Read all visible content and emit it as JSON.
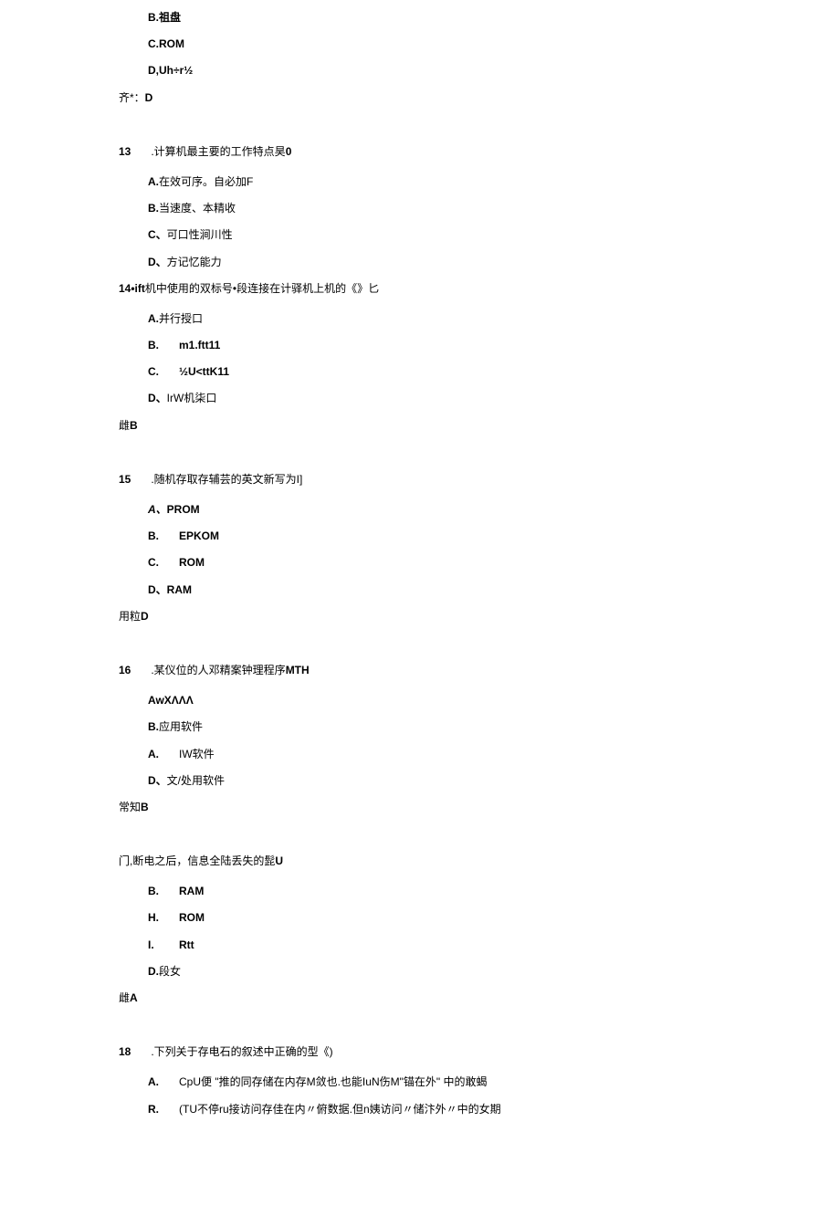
{
  "q12": {
    "optB": "B.祖盘",
    "optC": "C.ROM",
    "optD": "D,Uh÷r½",
    "answer_pre": "齐*：",
    "answer_val": "D"
  },
  "q13": {
    "num": "13",
    "text": ".计算机最主要的工作特点昊",
    "end": "0",
    "optA_pre": "A.",
    "optA": "在效可序。自必加F",
    "optB_pre": "B.",
    "optB": "当速度、本精收",
    "optC_pre": "C、",
    "optC": "可口性涧川性",
    "optD_pre": "D、",
    "optD": "方记忆能力"
  },
  "q14": {
    "num": "14•ift",
    "text": "机中使用的双标号•段连接在计驿机上机的《》匕",
    "optA_pre": "A.",
    "optA": "并行授口",
    "optB_pre": "B.",
    "optB": "m1.ftt11",
    "optC_pre": "C.",
    "optC": "½U<ttK11",
    "optD_pre": "D、",
    "optD": "IrW机柒口",
    "answer_pre": "雌",
    "answer_val": "B"
  },
  "q15": {
    "num": "15",
    "text": ".随机存取存辅芸的英文新写为I]",
    "optA_pre": "A、",
    "optA": "PROM",
    "optB_pre": "B.",
    "optB": "EPKOM",
    "optC_pre": "C.",
    "optC": "ROM",
    "optD_pre": "D、",
    "optD": "RAM",
    "answer_pre": "用粒",
    "answer_val": "D"
  },
  "q16": {
    "num": "16",
    "text": ".某仪位的人邓精案钟理程序",
    "end": "MTH",
    "optA": "AwXΛΛΛ",
    "optB_pre": "B.",
    "optB": "应用软件",
    "optC_pre": "A.",
    "optC": "IW软件",
    "optD_pre": "D、",
    "optD": "文/处用软件",
    "answer_pre": "常知",
    "answer_val": "B"
  },
  "q17": {
    "text_pre": "门,断电之后，信息全陆丢失的髭",
    "text_end": "U",
    "optA_pre": "B.",
    "optA": "RAM",
    "optB_pre": "H.",
    "optB": "ROM",
    "optC_pre": "I.",
    "optC": "Rtt",
    "optD_pre": "D.",
    "optD": "段女",
    "answer_pre": "雌",
    "answer_val": "A"
  },
  "q18": {
    "num": "18",
    "text": ".下列关于存电石的叙述中正确的型《)",
    "optA_pre": "A.",
    "optA": "CpU便 \"推的同存储在内存M敛也.也能IuN伤M\"锚在外\" 中的敢蝎",
    "optB_pre": "R.",
    "optB": "(TU不停ru接访问存佳在内〃俯数据.但n姨访问〃储汴外〃中的女期"
  }
}
